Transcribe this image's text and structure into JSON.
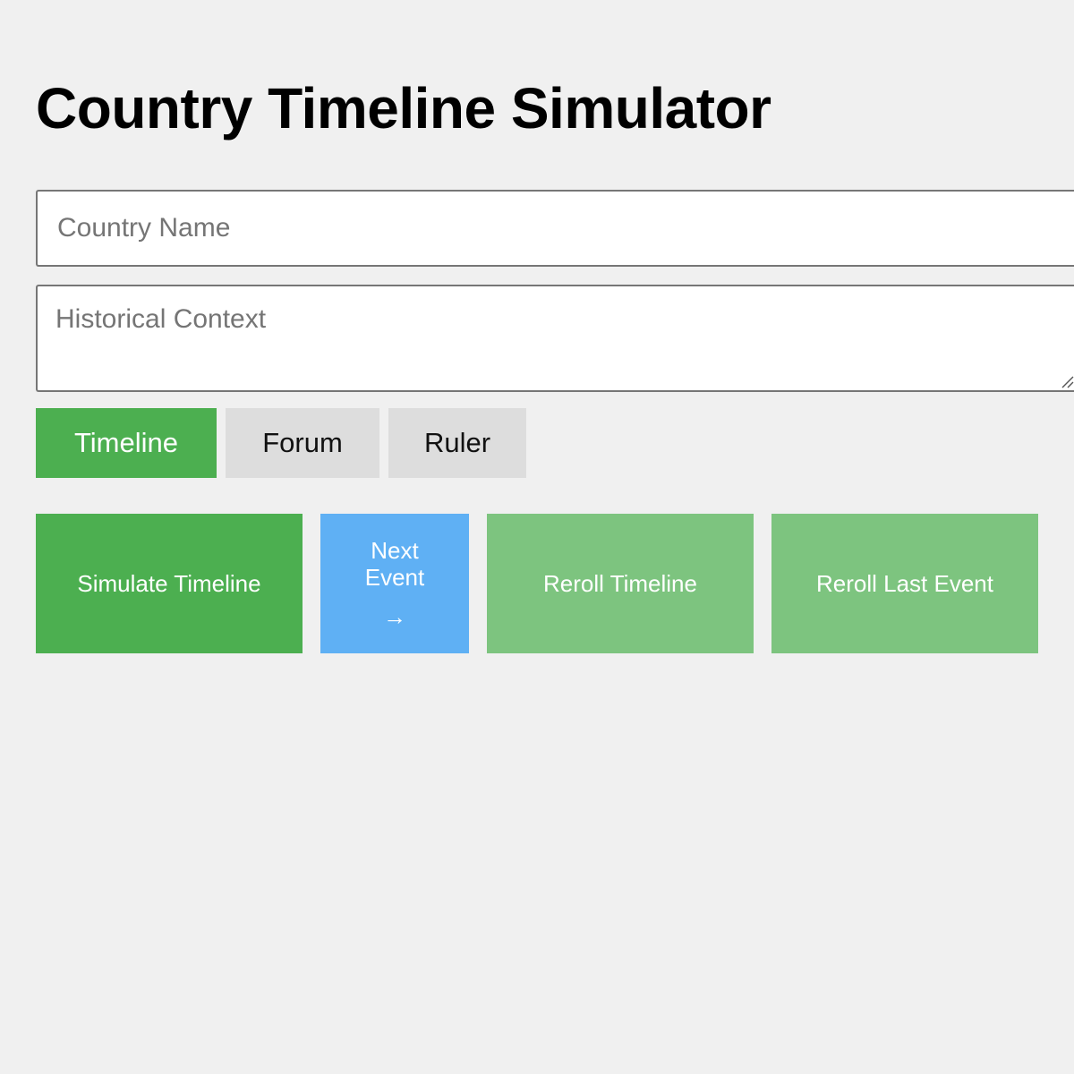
{
  "header": {
    "title": "Country Timeline Simulator"
  },
  "form": {
    "country_placeholder": "Country Name",
    "country_value": "",
    "context_placeholder": "Historical Context",
    "context_value": ""
  },
  "tabs": [
    {
      "label": "Timeline",
      "active": true
    },
    {
      "label": "Forum",
      "active": false
    },
    {
      "label": "Ruler",
      "active": false
    }
  ],
  "actions": {
    "simulate_label": "Simulate Timeline",
    "next_label": "Next Event",
    "next_icon": "→",
    "reroll_label": "Reroll Timeline",
    "reroll_last_label": "Reroll Last Event"
  },
  "colors": {
    "background": "#f0f0f0",
    "primary_green": "#4caf50",
    "disabled_green": "#7dc47f",
    "blue": "#5fb0f4",
    "inactive_tab": "#dddddd"
  }
}
